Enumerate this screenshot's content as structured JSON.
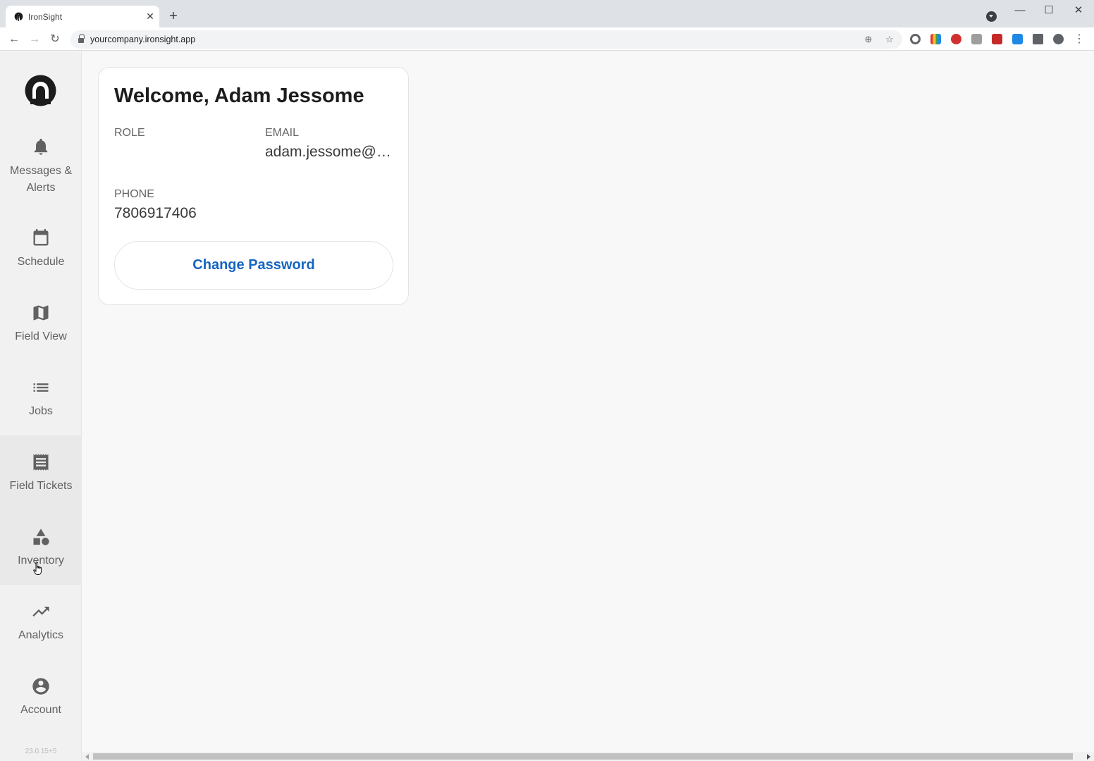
{
  "browser": {
    "tab_title": "IronSight",
    "tab_close": "✕",
    "new_tab": "+",
    "url": "yourcompany.ironsight.app",
    "window_controls": {
      "minimize": "—",
      "maximize": "☐",
      "close": "✕"
    }
  },
  "sidebar": {
    "items": [
      {
        "label": "Messages &\nAlerts",
        "icon": "bell-icon"
      },
      {
        "label": "Schedule",
        "icon": "calendar-icon"
      },
      {
        "label": "Field View",
        "icon": "map-icon"
      },
      {
        "label": "Jobs",
        "icon": "list-icon"
      },
      {
        "label": "Field Tickets",
        "icon": "receipt-icon"
      },
      {
        "label": "Inventory",
        "icon": "shapes-icon"
      },
      {
        "label": "Analytics",
        "icon": "trending-up-icon"
      },
      {
        "label": "Account",
        "icon": "account-circle-icon"
      }
    ],
    "version": "23.0.15+5"
  },
  "profile": {
    "welcome": "Welcome, Adam Jessome",
    "role_label": "ROLE",
    "role_value": "",
    "email_label": "EMAIL",
    "email_value": "adam.jessome@p...",
    "phone_label": "PHONE",
    "phone_value": "7806917406",
    "change_password_label": "Change Password"
  },
  "colors": {
    "accent": "#1565c0",
    "sidebar_bg": "#f1f1f1",
    "page_bg": "#f8f8f8",
    "icon_gray": "#616161"
  }
}
